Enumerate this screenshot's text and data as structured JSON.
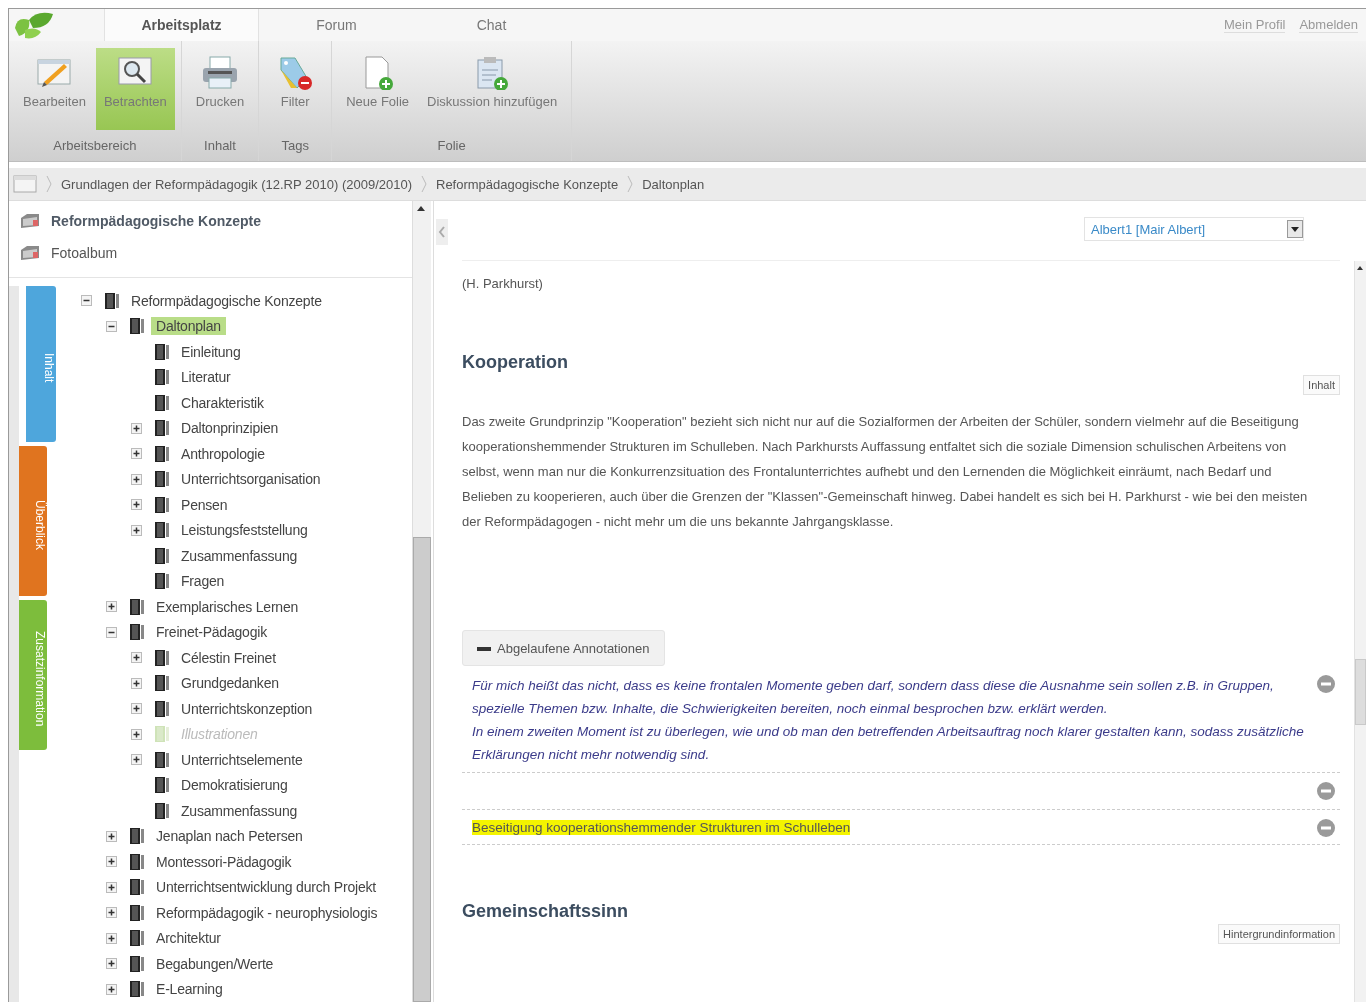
{
  "header": {
    "tabs": [
      {
        "label": "Arbeitsplatz",
        "selected": true
      },
      {
        "label": "Forum",
        "selected": false
      },
      {
        "label": "Chat",
        "selected": false
      }
    ],
    "links": [
      "Mein Profil",
      "Abmelden"
    ]
  },
  "ribbon": {
    "groups": [
      {
        "label": "Arbeitsbereich",
        "buttons": [
          {
            "label": "Bearbeiten",
            "kind": "edit",
            "selected": false
          },
          {
            "label": "Betrachten",
            "kind": "view",
            "selected": true
          }
        ]
      },
      {
        "label": "Inhalt",
        "buttons": [
          {
            "label": "Drucken",
            "kind": "print",
            "selected": false
          }
        ]
      },
      {
        "label": "Tags",
        "buttons": [
          {
            "label": "Filter",
            "kind": "filter",
            "selected": false
          }
        ]
      },
      {
        "label": "Folie",
        "buttons": [
          {
            "label": "Neue Folie",
            "kind": "new-slide",
            "selected": false
          },
          {
            "label": "Diskussion hinzufügen",
            "kind": "add-discussion",
            "selected": false
          }
        ]
      }
    ]
  },
  "breadcrumb": [
    "Grundlagen der Reformpädagogik (12.RP 2010) (2009/2010)",
    "Reformpädagogische Konzepte",
    "Daltonplan"
  ],
  "sidebar": {
    "items": [
      {
        "label": "Reformpädagogische Konzepte",
        "selected": true
      },
      {
        "label": "Fotoalbum",
        "selected": false
      }
    ],
    "tabs": [
      {
        "label": "Inhalt",
        "color": "#4ea6dc",
        "selected": true
      },
      {
        "label": "Überblick",
        "color": "#e0741f",
        "selected": false
      },
      {
        "label": "Zusatzinformation",
        "color": "#7dbd3c",
        "selected": false
      }
    ],
    "tree": [
      {
        "label": "Reformpädagogische Konzepte",
        "kind": "branch",
        "expanded": true,
        "selected": false,
        "disabled": false,
        "children": [
          {
            "label": "Daltonplan",
            "kind": "branch",
            "expanded": true,
            "selected": true,
            "disabled": false,
            "children": [
              {
                "label": "Einleitung",
                "kind": "leaf",
                "selected": false,
                "disabled": false
              },
              {
                "label": "Literatur",
                "kind": "leaf",
                "selected": false,
                "disabled": false
              },
              {
                "label": "Charakteristik",
                "kind": "leaf",
                "selected": false,
                "disabled": false
              },
              {
                "label": "Daltonprinzipien",
                "kind": "branch",
                "expanded": false,
                "selected": false,
                "disabled": false
              },
              {
                "label": "Anthropologie",
                "kind": "branch",
                "expanded": false,
                "selected": false,
                "disabled": false
              },
              {
                "label": "Unterrichtsorganisation",
                "kind": "branch",
                "expanded": false,
                "selected": false,
                "disabled": false
              },
              {
                "label": "Pensen",
                "kind": "branch",
                "expanded": false,
                "selected": false,
                "disabled": false
              },
              {
                "label": "Leistungsfeststellung",
                "kind": "branch",
                "expanded": false,
                "selected": false,
                "disabled": false
              },
              {
                "label": "Zusammenfassung",
                "kind": "leaf",
                "selected": false,
                "disabled": false
              },
              {
                "label": "Fragen",
                "kind": "leaf",
                "selected": false,
                "disabled": false
              }
            ]
          },
          {
            "label": "Exemplarisches Lernen",
            "kind": "branch",
            "expanded": false,
            "selected": false,
            "disabled": false
          },
          {
            "label": "Freinet-Pädagogik",
            "kind": "branch",
            "expanded": true,
            "selected": false,
            "disabled": false,
            "children": [
              {
                "label": "Célestin Freinet",
                "kind": "branch",
                "expanded": false,
                "selected": false,
                "disabled": false
              },
              {
                "label": "Grundgedanken",
                "kind": "branch",
                "expanded": false,
                "selected": false,
                "disabled": false
              },
              {
                "label": "Unterrichtskonzeption",
                "kind": "branch",
                "expanded": false,
                "selected": false,
                "disabled": false
              },
              {
                "label": "Illustrationen",
                "kind": "branch",
                "expanded": false,
                "selected": false,
                "disabled": true
              },
              {
                "label": "Unterrichtselemente",
                "kind": "branch",
                "expanded": false,
                "selected": false,
                "disabled": false
              },
              {
                "label": "Demokratisierung",
                "kind": "leaf",
                "selected": false,
                "disabled": false
              },
              {
                "label": "Zusammenfassung",
                "kind": "leaf",
                "selected": false,
                "disabled": false
              }
            ]
          },
          {
            "label": "Jenaplan nach Petersen",
            "kind": "branch",
            "expanded": false,
            "selected": false,
            "disabled": false
          },
          {
            "label": "Montessori-Pädagogik",
            "kind": "branch",
            "expanded": false,
            "selected": false,
            "disabled": false
          },
          {
            "label": "Unterrichtsentwicklung durch Projekt",
            "kind": "branch",
            "expanded": false,
            "selected": false,
            "disabled": false
          },
          {
            "label": "Reformpädagogik - neurophysiologis",
            "kind": "branch",
            "expanded": false,
            "selected": false,
            "disabled": false
          },
          {
            "label": "Architektur",
            "kind": "branch",
            "expanded": false,
            "selected": false,
            "disabled": false
          },
          {
            "label": "Begabungen/Werte",
            "kind": "branch",
            "expanded": false,
            "selected": false,
            "disabled": false
          },
          {
            "label": "E-Learning",
            "kind": "branch",
            "expanded": false,
            "selected": false,
            "disabled": false
          }
        ]
      }
    ]
  },
  "content": {
    "user_select": {
      "value": "Albert1 [Mair Albert]"
    },
    "sections": [
      {
        "kind": "text",
        "paragraphs": [
          "(H. Parkhurst)"
        ]
      },
      {
        "kind": "heading",
        "title": "Kooperation",
        "tag": "Inhalt"
      },
      {
        "kind": "text",
        "paragraphs": [
          "Das zweite Grundprinzip \"Kooperation\" bezieht sich nicht nur auf die Sozialformen der Arbeiten der Schüler, sondern vielmehr auf die Beseitigung kooperationshemmender Strukturen im Schulleben. Nach Parkhursts Auffassung entfaltet sich die soziale Dimension schulischen Arbeitens von selbst, wenn man nur die Konkurrenzsituation des Frontalunterrichtes aufhebt und den Lernenden die Möglichkeit einräumt, nach Bedarf und Belieben zu kooperieren, auch über die Grenzen der \"Klassen\"-Gemeinschaft hinweg. Dabei handelt es sich bei H. Parkhurst - wie bei den meisten der Reformpädagogen - nicht mehr um die uns bekannte Jahrgangsklasse."
        ]
      },
      {
        "kind": "annotations",
        "toggle": {
          "label": "Abgelaufene Annotationen",
          "expanded": true
        },
        "items": [
          {
            "kind": "comment",
            "paragraphs": [
              "Für mich heißt das nicht, dass es keine frontalen Momente geben darf, sondern dass diese die Ausnahme sein sollen z.B. in Gruppen, spezielle Themen bzw. Inhalte, die Schwierigkeiten bereiten, noch einmal besprochen bzw. erklärt werden.",
              "In einem zweiten Moment ist zu überlegen, wie und ob man den betreffenden Arbeitsauftrag noch klarer gestalten kann, sodass zusätzliche Erklärungen nicht mehr notwendig sind."
            ]
          },
          {
            "kind": "empty"
          },
          {
            "kind": "highlight",
            "text": "Beseitigung kooperationshemmender Strukturen im Schulleben"
          }
        ]
      },
      {
        "kind": "heading",
        "title": "Gemeinschaftssinn",
        "tag": "Hintergrundinformation"
      }
    ]
  }
}
